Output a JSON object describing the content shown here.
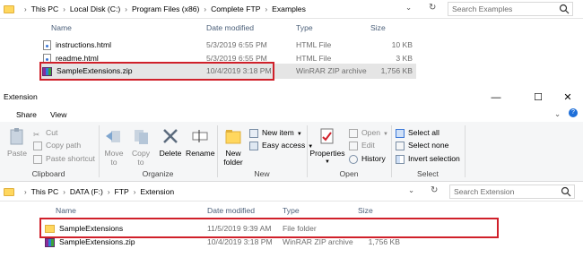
{
  "top_pane": {
    "breadcrumb": [
      "This PC",
      "Local Disk (C:)",
      "Program Files (x86)",
      "Complete FTP",
      "Examples"
    ],
    "search_placeholder": "Search Examples",
    "columns": [
      "Name",
      "Date modified",
      "Type",
      "Size"
    ],
    "files": [
      {
        "name": "instructions.html",
        "date": "5/3/2019 6:55 PM",
        "type": "HTML File",
        "size": "10 KB",
        "icon": "html-file-icon"
      },
      {
        "name": "readme.html",
        "date": "5/3/2019 6:55 PM",
        "type": "HTML File",
        "size": "3 KB",
        "icon": "html-file-icon"
      },
      {
        "name": "SampleExtensions.zip",
        "date": "10/4/2019 3:18 PM",
        "type": "WinRAR ZIP archive",
        "size": "1,756 KB",
        "icon": "winrar-zip-icon"
      }
    ]
  },
  "window": {
    "title": "Extension",
    "controls": {
      "minimize": "—",
      "maximize": "☐",
      "close": "✕"
    },
    "tabs": [
      "Share",
      "View"
    ],
    "ribbon": {
      "clipboard": {
        "label": "Clipboard",
        "paste": "Paste",
        "cut": "Cut",
        "copy_path": "Copy path",
        "paste_shortcut": "Paste shortcut"
      },
      "organize": {
        "label": "Organize",
        "move_to": [
          "Move",
          "to"
        ],
        "copy_to": [
          "Copy",
          "to"
        ],
        "delete": "Delete",
        "rename": "Rename"
      },
      "new": {
        "label": "New",
        "new_folder": [
          "New",
          "folder"
        ],
        "new_item": "New item",
        "easy_access": "Easy access"
      },
      "open": {
        "label": "Open",
        "properties": "Properties",
        "open": "Open",
        "edit": "Edit",
        "history": "History"
      },
      "select": {
        "label": "Select",
        "select_all": "Select all",
        "select_none": "Select none",
        "invert_selection": "Invert selection"
      }
    },
    "breadcrumb": [
      "This PC",
      "DATA (F:)",
      "FTP",
      "Extension"
    ],
    "search_placeholder": "Search Extension",
    "columns": [
      "Name",
      "Date modified",
      "Type",
      "Size"
    ],
    "files": [
      {
        "name": "SampleExtensions",
        "date": "11/5/2019 9:39 AM",
        "type": "File folder",
        "size": "",
        "icon": "folder-icon"
      },
      {
        "name": "SampleExtensions.zip",
        "date": "10/4/2019 3:18 PM",
        "type": "WinRAR ZIP archive",
        "size": "1,756 KB",
        "icon": "winrar-zip-icon"
      }
    ]
  },
  "colors": {
    "highlight_border": "#d0202a",
    "selected_row": "#e5e5e5",
    "header_text": "#4c607a"
  }
}
